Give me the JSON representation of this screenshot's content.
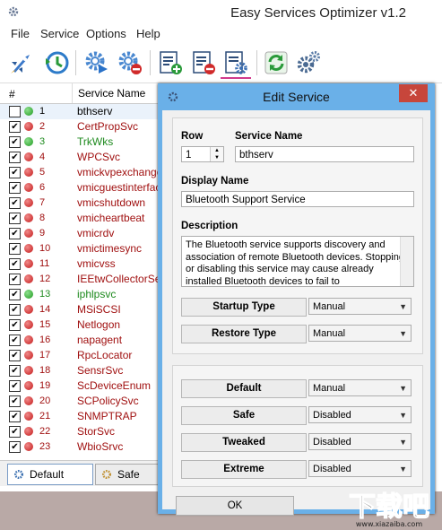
{
  "app": {
    "title": "Easy Services Optimizer v1.2",
    "menu": [
      "File",
      "Service",
      "Options",
      "Help"
    ]
  },
  "toolbar": {
    "icons": [
      "rocket-icon",
      "clock-restore-icon",
      "gear-play-icon",
      "gear-stop-icon",
      "add-list-icon",
      "remove-list-icon",
      "edit-list-icon",
      "refresh-icon",
      "settings-gears-icon"
    ]
  },
  "list": {
    "header_num": "#",
    "header_name": "Service Name",
    "rows": [
      {
        "num": "1",
        "name": "bthserv",
        "checked": false,
        "status": "green",
        "color": "#000000"
      },
      {
        "num": "2",
        "name": "CertPropSvc",
        "checked": true,
        "status": "red",
        "color": "#a01010"
      },
      {
        "num": "3",
        "name": "TrkWks",
        "checked": true,
        "status": "green",
        "color": "#1e8a1e"
      },
      {
        "num": "4",
        "name": "WPCSvc",
        "checked": true,
        "status": "red",
        "color": "#a01010"
      },
      {
        "num": "5",
        "name": "vmickvpexchange",
        "checked": true,
        "status": "red",
        "color": "#a01010"
      },
      {
        "num": "6",
        "name": "vmicguestinterface",
        "checked": true,
        "status": "red",
        "color": "#a01010"
      },
      {
        "num": "7",
        "name": "vmicshutdown",
        "checked": true,
        "status": "red",
        "color": "#a01010"
      },
      {
        "num": "8",
        "name": "vmicheartbeat",
        "checked": true,
        "status": "red",
        "color": "#a01010"
      },
      {
        "num": "9",
        "name": "vmicrdv",
        "checked": true,
        "status": "red",
        "color": "#a01010"
      },
      {
        "num": "10",
        "name": "vmictimesync",
        "checked": true,
        "status": "red",
        "color": "#a01010"
      },
      {
        "num": "11",
        "name": "vmicvss",
        "checked": true,
        "status": "red",
        "color": "#a01010"
      },
      {
        "num": "12",
        "name": "IEEtwCollectorServ",
        "checked": true,
        "status": "red",
        "color": "#a01010"
      },
      {
        "num": "13",
        "name": "iphlpsvc",
        "checked": true,
        "status": "green",
        "color": "#1e8a1e"
      },
      {
        "num": "14",
        "name": "MSiSCSI",
        "checked": true,
        "status": "red",
        "color": "#a01010"
      },
      {
        "num": "15",
        "name": "Netlogon",
        "checked": true,
        "status": "red",
        "color": "#a01010"
      },
      {
        "num": "16",
        "name": "napagent",
        "checked": true,
        "status": "red",
        "color": "#a01010"
      },
      {
        "num": "17",
        "name": "RpcLocator",
        "checked": true,
        "status": "red",
        "color": "#a01010"
      },
      {
        "num": "18",
        "name": "SensrSvc",
        "checked": true,
        "status": "red",
        "color": "#a01010"
      },
      {
        "num": "19",
        "name": "ScDeviceEnum",
        "checked": true,
        "status": "red",
        "color": "#a01010"
      },
      {
        "num": "20",
        "name": "SCPolicySvc",
        "checked": true,
        "status": "red",
        "color": "#a01010"
      },
      {
        "num": "21",
        "name": "SNMPTRAP",
        "checked": true,
        "status": "red",
        "color": "#a01010"
      },
      {
        "num": "22",
        "name": "StorSvc",
        "checked": true,
        "status": "red",
        "color": "#a01010"
      },
      {
        "num": "23",
        "name": "WbioSrvc",
        "checked": true,
        "status": "red",
        "color": "#a01010"
      }
    ]
  },
  "tabs": {
    "default": "Default",
    "safe": "Safe"
  },
  "dialog": {
    "title": "Edit Service",
    "close": "✕",
    "row_label": "Row",
    "row_value": "1",
    "service_name_label": "Service Name",
    "service_name_value": "bthserv",
    "display_name_label": "Display Name",
    "display_name_value": "Bluetooth Support Service",
    "description_label": "Description",
    "description_value": "The Bluetooth service supports discovery and association of remote Bluetooth devices. Stopping or disabling this service may cause already installed Bluetooth devices to fail to",
    "startup_type_label": "Startup Type",
    "startup_type_value": "Manual",
    "restore_type_label": "Restore Type",
    "restore_type_value": "Manual",
    "default_label": "Default",
    "default_value": "Manual",
    "safe_label": "Safe",
    "safe_value": "Disabled",
    "tweaked_label": "Tweaked",
    "tweaked_value": "Disabled",
    "extreme_label": "Extreme",
    "extreme_value": "Disabled",
    "ok": "OK"
  },
  "watermark": {
    "text": "下载吧",
    "url": "www.xiazaiba.com"
  }
}
